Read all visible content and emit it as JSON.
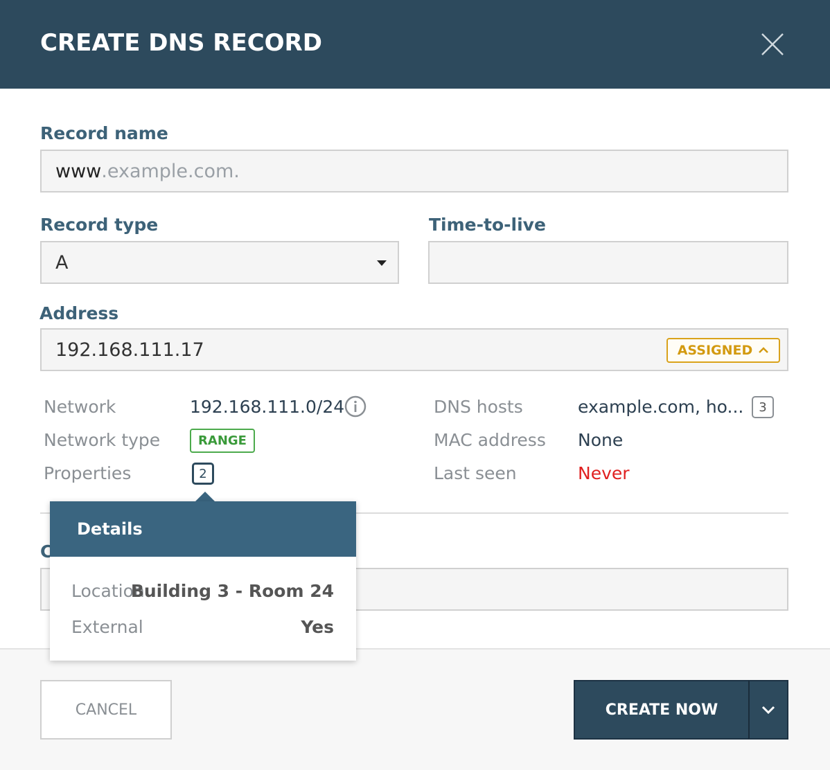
{
  "dialog": {
    "title": "CREATE DNS RECORD",
    "close_icon": "close-icon"
  },
  "form": {
    "record_name": {
      "label": "Record name",
      "value": "www",
      "placeholder_suffix": ".example.com."
    },
    "record_type": {
      "label": "Record type",
      "value": "A"
    },
    "ttl": {
      "label": "Time-to-live",
      "value": ""
    },
    "address": {
      "label": "Address",
      "value": "192.168.111.17",
      "status_badge": "ASSIGNED"
    },
    "comment": {
      "label": "C"
    }
  },
  "address_details": {
    "left": {
      "network_key": "Network",
      "network_val": "192.168.111.0/24",
      "network_type_key": "Network type",
      "network_type_val": "RANGE",
      "properties_key": "Properties",
      "properties_count": "2"
    },
    "right": {
      "dns_hosts_key": "DNS hosts",
      "dns_hosts_val": "example.com, ho...",
      "dns_hosts_count": "3",
      "mac_key": "MAC address",
      "mac_val": "None",
      "last_seen_key": "Last seen",
      "last_seen_val": "Never"
    }
  },
  "popover": {
    "title": "Details",
    "rows": [
      {
        "key": "Location",
        "value": "Building 3 - Room 24"
      },
      {
        "key": "External",
        "value": "Yes"
      }
    ]
  },
  "footer": {
    "cancel_label": "CANCEL",
    "create_label": "CREATE NOW"
  },
  "colors": {
    "header_bg": "#2d4a5d",
    "label": "#3d6278",
    "assigned": "#d9a21b",
    "range": "#4caa4c",
    "never": "#e02020",
    "popover_head": "#3a6580"
  }
}
